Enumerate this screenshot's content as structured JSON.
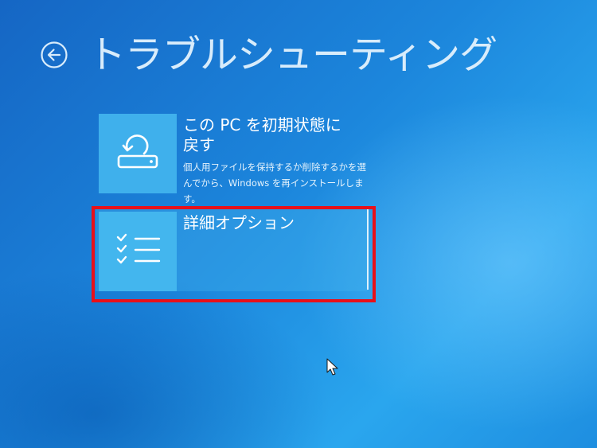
{
  "header": {
    "title": "トラブルシューティング",
    "back_icon": "back-arrow-icon"
  },
  "options": [
    {
      "title_line1": "この PC を初期状態に",
      "title_line2": "戻す",
      "description_line1": "個人用ファイルを保持するか削除するかを選",
      "description_line2": "んでから、Windows を再インストールします。",
      "icon": "reset-pc-icon"
    },
    {
      "title": "詳細オプション",
      "icon": "checklist-icon",
      "selected": true
    }
  ],
  "colors": {
    "background": "#1c86dc",
    "tile": "#3fb0ec",
    "highlight": "#e8101a",
    "text": "#ffffff"
  }
}
